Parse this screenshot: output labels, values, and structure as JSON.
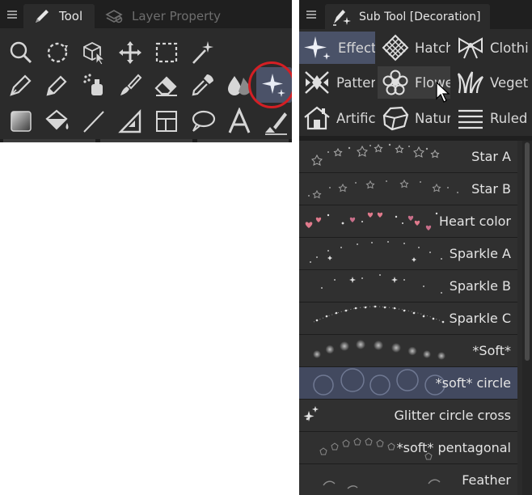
{
  "tool_panel": {
    "tabs": [
      {
        "label": "Tool",
        "icon": "pen-brush-icon",
        "active": true
      },
      {
        "label": "Layer Property",
        "icon": "layer-property-icon",
        "active": false
      }
    ],
    "tools": [
      [
        "zoom-icon",
        "lasso-select-icon",
        "operation-icon",
        "move-layer-icon",
        "rectangle-select-icon",
        "auto-select-wand-icon"
      ],
      [
        "pen-icon",
        "pencil-icon",
        "airbrush-icon",
        "brush-icon",
        "eraser-icon",
        "eyedropper-icon",
        "blend-icon",
        "decoration-sparkle-icon"
      ],
      [
        "gradient-icon",
        "fill-bucket-icon",
        "line-figure-icon",
        "ruler-icon",
        "frame-border-icon",
        "balloon-icon",
        "text-icon",
        "correct-line-icon"
      ]
    ],
    "selected_tool": "decoration-sparkle-icon",
    "highlight_color": "#d41f24"
  },
  "subtool_panel": {
    "tab": {
      "label": "Sub Tool [Decoration]",
      "icon": "decoration-brush-icon"
    },
    "groups": [
      {
        "label": "Effect",
        "icon": "sparkle-icon",
        "state": "active"
      },
      {
        "label": "Hatch",
        "icon": "hatch-icon",
        "state": "normal"
      },
      {
        "label": "Clothi",
        "icon": "ribbon-bow-icon",
        "state": "normal"
      },
      {
        "label": "Patter",
        "icon": "pattern-icon",
        "state": "normal"
      },
      {
        "label": "Flowe",
        "icon": "flower-icon",
        "state": "hover"
      },
      {
        "label": "Veget",
        "icon": "grass-icon",
        "state": "normal"
      },
      {
        "label": "Artifici",
        "icon": "house-icon",
        "state": "normal"
      },
      {
        "label": "Natura",
        "icon": "rock-icon",
        "state": "normal"
      },
      {
        "label": "Ruled",
        "icon": "ruled-lines-icon",
        "state": "normal"
      }
    ],
    "brushes": [
      {
        "name": "Star A",
        "preview": "stars-outline"
      },
      {
        "name": "Star B",
        "preview": "stars-dotted"
      },
      {
        "name": "Heart color",
        "preview": "hearts"
      },
      {
        "name": "Sparkle A",
        "preview": "sparkle-dots"
      },
      {
        "name": "Sparkle B",
        "preview": "sparkle-crosses"
      },
      {
        "name": "Sparkle C",
        "preview": "sparkle-chain"
      },
      {
        "name": "*Soft*",
        "preview": "soft-dots"
      },
      {
        "name": "*soft* circle",
        "preview": "soft-circles",
        "selected": true
      },
      {
        "name": "Glitter circle cross",
        "preview": "glitter-cross"
      },
      {
        "name": "*soft* pentagonal",
        "preview": "pentagons"
      },
      {
        "name": "Feather",
        "preview": "feathers"
      }
    ]
  }
}
